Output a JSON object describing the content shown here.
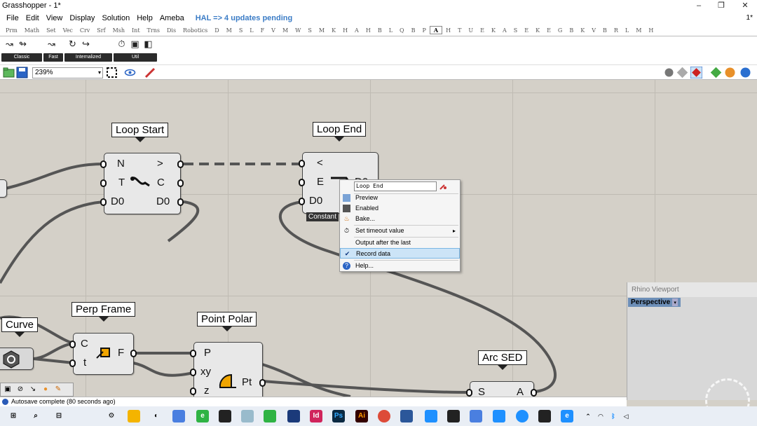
{
  "window": {
    "title": "Grasshopper - 1*",
    "corner_label": "1*"
  },
  "menu": {
    "items": [
      "File",
      "Edit",
      "View",
      "Display",
      "Solution",
      "Help",
      "Ameba"
    ],
    "hal_notice": "HAL => 4 updates pending"
  },
  "tabs": [
    "Prm",
    "Math",
    "Set",
    "Vec",
    "Crv",
    "Srf",
    "Msh",
    "Int",
    "Trns",
    "Dis",
    "Robotics",
    "D",
    "M",
    "S",
    "L",
    "F",
    "V",
    "M",
    "W",
    "S",
    "M",
    "K",
    "H",
    "A",
    "H",
    "B",
    "L",
    "Q",
    "B",
    "P",
    "A",
    "H",
    "T",
    "U",
    "E",
    "K",
    "A",
    "S",
    "E",
    "K",
    "E",
    "G",
    "B",
    "K",
    "V",
    "B",
    "R",
    "L",
    "M",
    "H"
  ],
  "active_tab_index": 30,
  "ribbon_groups": [
    "Classic",
    "Fast",
    "Internalized",
    "Util"
  ],
  "zoom": "239%",
  "components": {
    "loop_start": {
      "label": "Loop Start",
      "inputs": [
        "N",
        "T",
        "D0"
      ],
      "outputs": [
        ">",
        "C",
        "D0"
      ]
    },
    "loop_end": {
      "label": "Loop End",
      "inputs": [
        "<",
        "E",
        "D0"
      ],
      "output_partial": "D0",
      "badge": "Constant"
    },
    "curve": {
      "label": "Curve"
    },
    "perp_frame": {
      "label": "Perp Frame",
      "inputs": [
        "C",
        "t"
      ],
      "outputs": [
        "F"
      ]
    },
    "point_polar": {
      "label": "Point Polar",
      "inputs": [
        "P",
        "xy",
        "z"
      ],
      "outputs": [
        "Pt"
      ]
    },
    "arc_sed": {
      "label": "Arc SED",
      "inputs": [
        "S"
      ],
      "outputs": [
        "A"
      ]
    }
  },
  "context_menu": {
    "name_field": "Loop End",
    "items": [
      {
        "label": "Preview",
        "icon": "preview-icon"
      },
      {
        "label": "Enabled",
        "icon": "enabled-icon"
      },
      {
        "label": "Bake...",
        "icon": "bake-icon"
      },
      {
        "label": "Set timeout value",
        "icon": "timer-icon",
        "submenu": true
      },
      {
        "label": "Output after the last",
        "icon": ""
      },
      {
        "label": "Record data",
        "icon": "check-icon",
        "checked": true
      },
      {
        "label": "Help...",
        "icon": "help-icon"
      }
    ]
  },
  "viewport": {
    "title": "Rhino Viewport",
    "view": "Perspective"
  },
  "status": {
    "message": "Autosave complete (80 seconds ago)"
  },
  "colors": {
    "hal": "#3b7cc6",
    "highlight": "#cce4f7",
    "canvas": "#d4d0c8",
    "viewport_tab": "#6d8fb8"
  }
}
